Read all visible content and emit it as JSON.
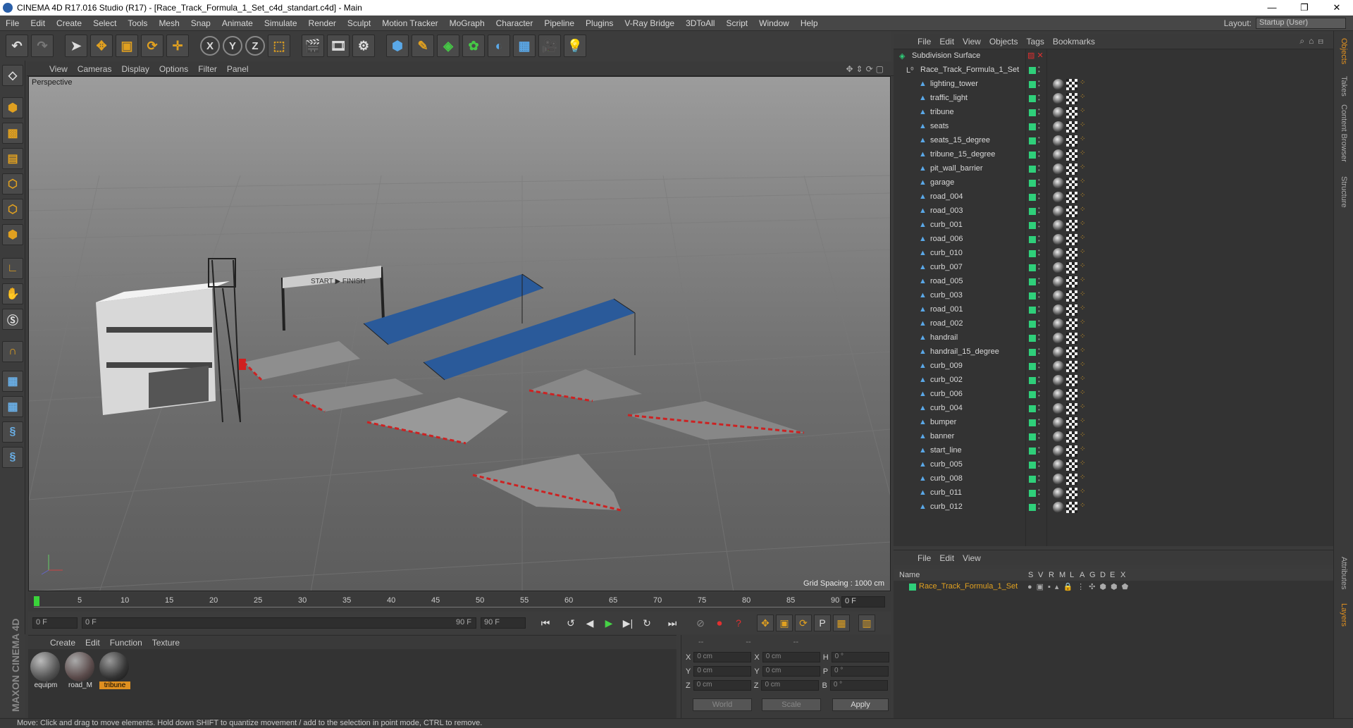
{
  "window": {
    "title": "CINEMA 4D R17.016 Studio (R17) - [Race_Track_Formula_1_Set_c4d_standart.c4d] - Main",
    "controls": [
      "—",
      "❐",
      "✕"
    ]
  },
  "menubar": {
    "items": [
      "File",
      "Edit",
      "Create",
      "Select",
      "Tools",
      "Mesh",
      "Snap",
      "Animate",
      "Simulate",
      "Render",
      "Sculpt",
      "Motion Tracker",
      "MoGraph",
      "Character",
      "Pipeline",
      "Plugins",
      "V-Ray Bridge",
      "3DToAll",
      "Script",
      "Window",
      "Help"
    ],
    "layout_label": "Layout:",
    "layout_value": "Startup (User)"
  },
  "toolbar": {
    "axis_x": "X",
    "axis_y": "Y",
    "axis_z": "Z"
  },
  "viewport": {
    "menu": [
      "View",
      "Cameras",
      "Display",
      "Options",
      "Filter",
      "Panel"
    ],
    "camera_label": "Perspective",
    "grid_spacing": "Grid Spacing : 1000 cm",
    "banner_text": "START ▶ FINISH"
  },
  "timeline": {
    "ticks": [
      "0",
      "5",
      "10",
      "15",
      "20",
      "25",
      "30",
      "35",
      "40",
      "45",
      "50",
      "55",
      "60",
      "65",
      "70",
      "75",
      "80",
      "85",
      "90"
    ],
    "current_frame": "0 F"
  },
  "transport": {
    "start": "0 F",
    "range_start": "0 F",
    "range_end": "90 F",
    "end": "90 F"
  },
  "materials": {
    "menu": [
      "Create",
      "Edit",
      "Function",
      "Texture"
    ],
    "items": [
      {
        "name": "equipm"
      },
      {
        "name": "road_M"
      },
      {
        "name": "tribune"
      }
    ],
    "selected": 2
  },
  "coords": {
    "header": [
      "--",
      "--",
      "--"
    ],
    "rows": [
      {
        "a": "X",
        "av": "0 cm",
        "b": "X",
        "bv": "0 cm",
        "c": "H",
        "cv": "0 °"
      },
      {
        "a": "Y",
        "av": "0 cm",
        "b": "Y",
        "bv": "0 cm",
        "c": "P",
        "cv": "0 °"
      },
      {
        "a": "Z",
        "av": "0 cm",
        "b": "Z",
        "bv": "0 cm",
        "c": "B",
        "cv": "0 °"
      }
    ],
    "world": "World",
    "scale": "Scale",
    "apply": "Apply"
  },
  "status": "Move: Click and drag to move elements. Hold down SHIFT to quantize movement / add to the selection in point mode, CTRL to remove.",
  "maxon": "MAXON CINEMA 4D",
  "object_manager": {
    "menu": [
      "File",
      "Edit",
      "View",
      "Objects",
      "Tags",
      "Bookmarks"
    ],
    "root": "Subdivision Surface",
    "group": "Race_Track_Formula_1_Set",
    "objects": [
      "lighting_tower",
      "traffic_light",
      "tribune",
      "seats",
      "seats_15_degree",
      "tribune_15_degree",
      "pit_wall_barrier",
      "garage",
      "road_004",
      "road_003",
      "curb_001",
      "road_006",
      "curb_010",
      "curb_007",
      "road_005",
      "curb_003",
      "road_001",
      "road_002",
      "handrail",
      "handrail_15_degree",
      "curb_009",
      "curb_002",
      "curb_006",
      "curb_004",
      "bumper",
      "banner",
      "start_line",
      "curb_005",
      "curb_008",
      "curb_011",
      "curb_012"
    ]
  },
  "side_tabs": [
    "Objects",
    "Takes",
    "Content Browser",
    "Structure",
    "Attributes",
    "Layers"
  ],
  "layers": {
    "menu": [
      "File",
      "Edit",
      "View"
    ],
    "columns": [
      "Name",
      "S",
      "V",
      "R",
      "M",
      "L",
      "A",
      "G",
      "D",
      "E",
      "X"
    ],
    "rows": [
      {
        "name": "Race_Track_Formula_1_Set"
      }
    ]
  }
}
